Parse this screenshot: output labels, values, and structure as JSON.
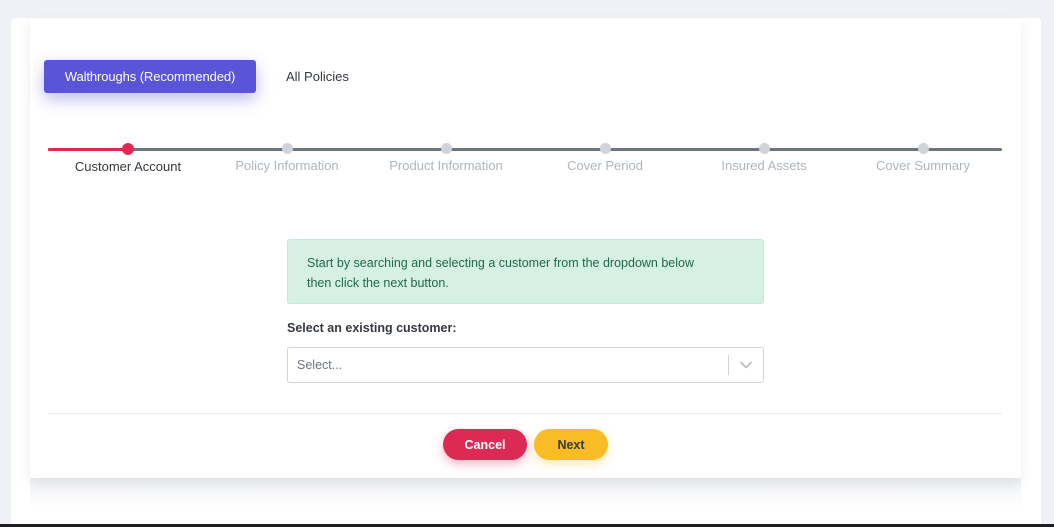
{
  "tabs": {
    "active_label": "Walthroughs (Recommended)",
    "other_label": "All Policies"
  },
  "stepper": {
    "steps": [
      {
        "label": "Customer Account",
        "state": "active"
      },
      {
        "label": "Policy Information",
        "state": "pending"
      },
      {
        "label": "Product Information",
        "state": "pending"
      },
      {
        "label": "Cover Period",
        "state": "pending"
      },
      {
        "label": "Insured Assets",
        "state": "pending"
      },
      {
        "label": "Cover Summary",
        "state": "pending"
      }
    ]
  },
  "alert": {
    "line1": "Start by searching and selecting a customer from the dropdown below",
    "line2": "then click the next button."
  },
  "customer_select": {
    "label": "Select an existing customer:",
    "placeholder": "Select...",
    "arrow_icon": "chevron-down-icon"
  },
  "actions": {
    "cancel_label": "Cancel",
    "next_label": "Next"
  },
  "colors": {
    "primary": "#5a54d9",
    "danger": "#dc2a55",
    "warning": "#f9bc25",
    "success_bg": "#d6f1e4"
  }
}
